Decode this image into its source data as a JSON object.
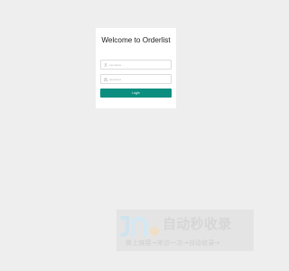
{
  "login": {
    "title": "Welcome to Orderlist",
    "username": {
      "value": "",
      "placeholder": "username",
      "icon": "user-icon"
    },
    "password": {
      "value": "",
      "placeholder": "password",
      "icon": "lock-icon"
    },
    "submit_label": "Login"
  },
  "colors": {
    "page_background": "#eeeeee",
    "card_background": "#ffffff",
    "accent": "#0b8e7f"
  },
  "watermark": {
    "logo": "logo-mark",
    "text": "自动秒收录",
    "subtitle": "做上链接→来访一次→自动收录→"
  }
}
